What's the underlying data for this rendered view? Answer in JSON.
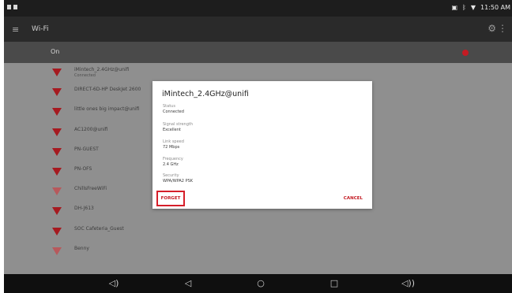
{
  "status_bar": {
    "time": "11:50 AM",
    "icons": [
      "nfc-icon",
      "bluetooth-icon",
      "wifi-icon"
    ]
  },
  "app_bar": {
    "title": "Wi-Fi"
  },
  "on_bar": {
    "label": "On",
    "toggle_color": "#c41b23"
  },
  "networks": [
    {
      "name": "iMintech_2.4GHz@unifi",
      "sub": "Connected"
    },
    {
      "name": "DIRECT-6D-HP DeskJet 2600",
      "sub": ""
    },
    {
      "name": "little ones big impact@unifi",
      "sub": ""
    },
    {
      "name": "AC1200@unifi",
      "sub": ""
    },
    {
      "name": "PN-GUEST",
      "sub": ""
    },
    {
      "name": "PN-OFS",
      "sub": ""
    },
    {
      "name": "ChillsFreeWiFi",
      "sub": ""
    },
    {
      "name": "DH-J613",
      "sub": ""
    },
    {
      "name": "SOC Cafeteria_Guest",
      "sub": ""
    },
    {
      "name": "Benny",
      "sub": ""
    }
  ],
  "dialog": {
    "title": "iMintech_2.4GHz@unifi",
    "fields": [
      {
        "label": "Status",
        "value": "Connected"
      },
      {
        "label": "Signal strength",
        "value": "Excellent"
      },
      {
        "label": "Link speed",
        "value": "72 Mbps"
      },
      {
        "label": "Frequency",
        "value": "2.4 GHz"
      },
      {
        "label": "Security",
        "value": "WPA/WPA2 PSK"
      }
    ],
    "forget_label": "FORGET",
    "cancel_label": "CANCEL",
    "accent_color": "#c41b23"
  },
  "nav_bar": {
    "icons": [
      "volume-down-icon",
      "back-icon",
      "home-icon",
      "recents-icon",
      "volume-up-icon"
    ]
  }
}
